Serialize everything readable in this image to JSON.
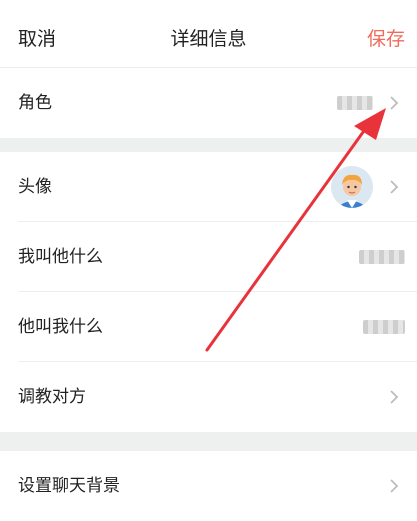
{
  "header": {
    "cancel_label": "取消",
    "title": "详细信息",
    "save_label": "保存"
  },
  "group1": {
    "role_label": "角色"
  },
  "group2": {
    "avatar_label": "头像",
    "what_i_call_them_label": "我叫他什么",
    "what_they_call_me_label": "他叫我什么",
    "train_label": "调教对方"
  },
  "group3": {
    "chat_bg_label": "设置聊天背景"
  },
  "colors": {
    "accent": "#f16b5a",
    "annotation_arrow": "#e8333a",
    "background": "#eef0ef"
  }
}
